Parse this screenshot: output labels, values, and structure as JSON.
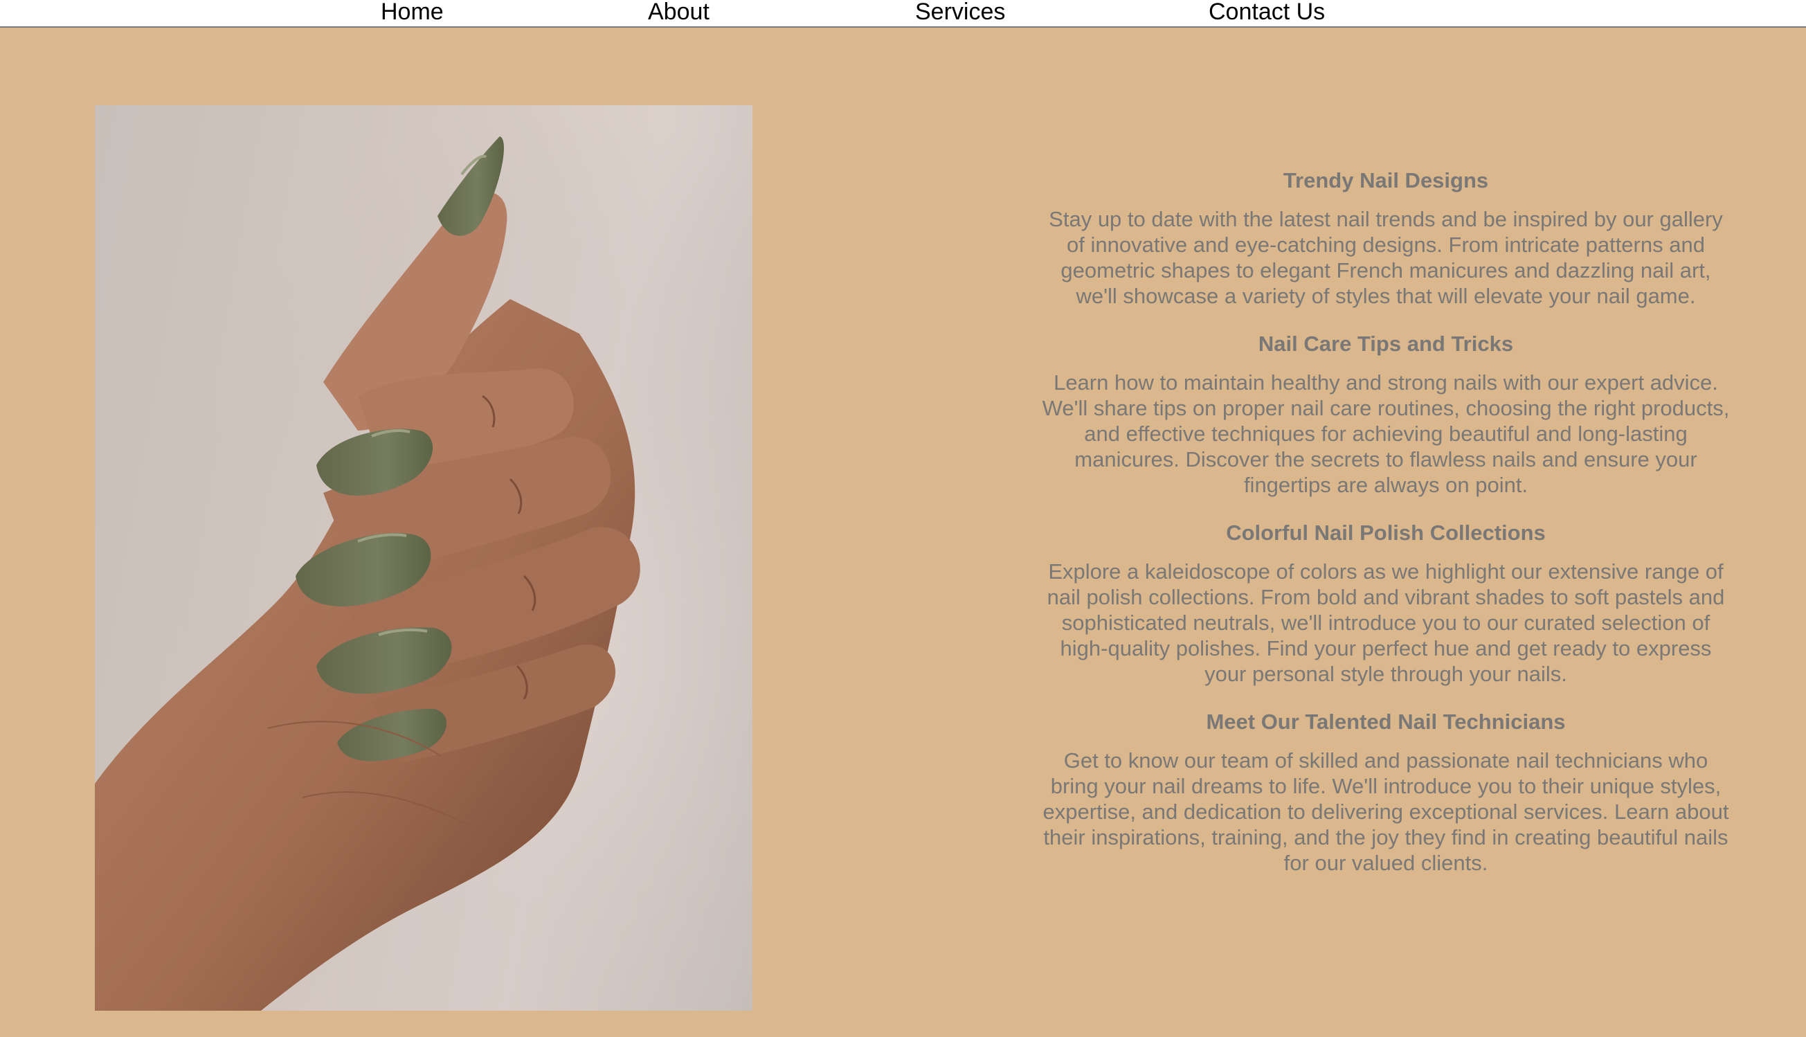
{
  "nav": {
    "items": [
      {
        "label": "Home"
      },
      {
        "label": "About"
      },
      {
        "label": "Services"
      },
      {
        "label": "Contact Us"
      }
    ]
  },
  "hero_image": {
    "icon": "manicured-hand-photo",
    "nail_color": "#6f7558",
    "skin_color": "#a9765b"
  },
  "sections": [
    {
      "heading": "Trendy Nail Designs",
      "body": "Stay up to date with the latest nail trends and be inspired by our gallery of innovative and eye-catching designs. From intricate patterns and geometric shapes to elegant French manicures and dazzling nail art, we'll showcase a variety of styles that will elevate your nail game."
    },
    {
      "heading": "Nail Care Tips and Tricks",
      "body": "Learn how to maintain healthy and strong nails with our expert advice. We'll share tips on proper nail care routines, choosing the right products, and effective techniques for achieving beautiful and long-lasting manicures. Discover the secrets to flawless nails and ensure your fingertips are always on point."
    },
    {
      "heading": "Colorful Nail Polish Collections",
      "body": "Explore a kaleidoscope of colors as we highlight our extensive range of nail polish collections. From bold and vibrant shades to soft pastels and sophisticated neutrals, we'll introduce you to our curated selection of high-quality polishes. Find your perfect hue and get ready to express your personal style through your nails."
    },
    {
      "heading": "Meet Our Talented Nail Technicians",
      "body": "Get to know our team of skilled and passionate nail technicians who bring your nail dreams to life. We'll introduce you to their unique styles, expertise, and dedication to delivering exceptional services. Learn about their inspirations, training, and the joy they find in creating beautiful nails for our valued clients."
    }
  ],
  "colors": {
    "page_background": "#dab78c",
    "nav_background": "#ffffff",
    "text": "#7a7876"
  }
}
